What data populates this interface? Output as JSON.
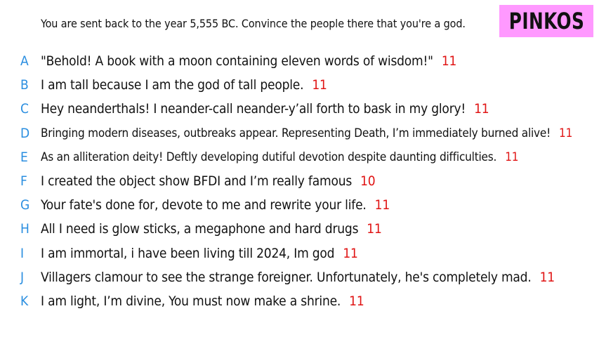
{
  "prompt": "You are sent back to the year 5,555 BC. Convince the people there that you're a god.",
  "logo": "PINKOS",
  "colors": {
    "letter": "#2a8ee0",
    "score": "#e01414",
    "logo_bg": "#ff99ff"
  },
  "answers": [
    {
      "letter": "A",
      "text": "\"Behold! A book with a moon containing eleven words of wisdom!\"",
      "score": "11"
    },
    {
      "letter": "B",
      "text": "I am tall because I am the god of tall people.",
      "score": "11"
    },
    {
      "letter": "C",
      "text": "Hey neanderthals! I neander-call neander-y’all forth to bask in my glory!",
      "score": "11"
    },
    {
      "letter": "D",
      "text": "Bringing modern diseases, outbreaks appear. Representing Death, I’m immediately burned alive!",
      "score": "11"
    },
    {
      "letter": "E",
      "text": "As an alliteration deity! Deftly developing dutiful devotion despite daunting difficulties.",
      "score": "11"
    },
    {
      "letter": "F",
      "text": "I created the object show BFDI and I’m really famous",
      "score": "10"
    },
    {
      "letter": "G",
      "text": "Your fate's done for, devote to me and rewrite your life.",
      "score": "11"
    },
    {
      "letter": "H",
      "text": "All I need is glow sticks, a megaphone and hard drugs",
      "score": "11"
    },
    {
      "letter": "I",
      "text": "I am immortal, i have been living till 2024, Im god",
      "score": "11"
    },
    {
      "letter": "J",
      "text": "Villagers clamour to see the strange foreigner. Unfortunately, he's completely mad.",
      "score": "11"
    },
    {
      "letter": "K",
      "text": "I am light, I’m divine, You must now make a shrine.",
      "score": "11"
    }
  ]
}
